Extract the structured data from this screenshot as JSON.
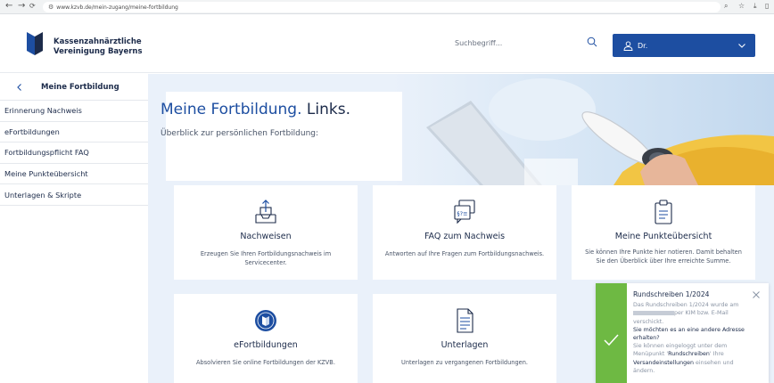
{
  "browser": {
    "url": "www.kzvb.de/mein-zugang/meine-fortbildung",
    "back_icon": "arrow-left-icon",
    "forward_icon": "arrow-right-icon",
    "reload_icon": "reload-icon"
  },
  "header": {
    "logo_line1": "Kassenzahnärztliche",
    "logo_line2": "Vereinigung Bayerns",
    "search_placeholder": "Suchbegriff...",
    "user_label": "Dr."
  },
  "sidebar": {
    "title": "Meine Fortbildung",
    "items": [
      {
        "label": "Erinnerung Nachweis"
      },
      {
        "label": "eFortbildungen"
      },
      {
        "label": "Fortbildungspflicht FAQ"
      },
      {
        "label": "Meine Punkteübersicht"
      },
      {
        "label": "Unterlagen & Skripte"
      }
    ]
  },
  "hero": {
    "title_main": "Meine Fortbildung.",
    "title_links": " Links.",
    "subtitle": "Überblick zur persönlichen Fortbildung:"
  },
  "cards": [
    {
      "title": "Nachweisen",
      "desc": "Erzeugen Sie Ihren Fortbildungsnachweis im Servicecenter.",
      "icon": "tray-upload-icon"
    },
    {
      "title": "FAQ zum Nachweis",
      "desc": "Antworten auf Ihre Fragen zum Fortbildungsnachweis.",
      "icon": "chat-faq-icon"
    },
    {
      "title": "Meine Punkteübersicht",
      "desc": "Sie können Ihre Punkte hier notieren. Damit behalten Sie den Überblick über Ihre erreichte Summe.",
      "icon": "clipboard-icon"
    },
    {
      "title": "eFortbildungen",
      "desc": "Absolvieren Sie online Fortbildungen der KZVB.",
      "icon": "efortbildung-badge-icon"
    },
    {
      "title": "Unterlagen",
      "desc": "Unterlagen zu vergangenen Fortbildungen.",
      "icon": "document-icon"
    }
  ],
  "toast": {
    "title": "Rundschreiben 1/2024",
    "line1": "Das Rundschreiben 1/2024 wurde am",
    "line2": "per KIM bzw. E-Mail",
    "line3": "verschickt.",
    "question": "Sie möchten es an eine andere Adresse erhalten?",
    "line4": "Sie können eingeloggt unter dem",
    "line5a": "Menüpunkt '",
    "line5b": "Rundschreiben",
    "line5c": "' Ihre",
    "line6a": "Versandeinstellungen",
    "line6b": " einsehen und",
    "line7": "ändern.",
    "accent": "#6eb943"
  },
  "colors": {
    "brand_blue": "#1d4ea1",
    "text_dark": "#1c2b4a",
    "main_bg": "#eaf1fa",
    "success_green": "#6eb943"
  }
}
